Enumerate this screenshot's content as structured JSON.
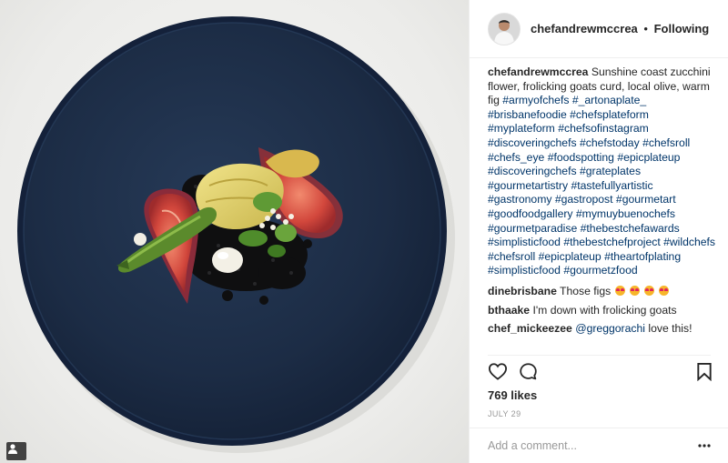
{
  "post": {
    "username": "chefandrewmccrea",
    "separator": "•",
    "follow_status": "Following",
    "caption": {
      "author": "chefandrewmccrea",
      "text": "Sunshine coast zucchini flower, frolicking goats curd, local olive, warm fig",
      "hashtags": [
        "#armyofchefs",
        "#_artonaplate_",
        "#brisbanefoodie",
        "#chefsplateform",
        "#myplateform",
        "#chefsofinstagram",
        "#discoveringchefs",
        "#chefstoday",
        "#chefsroll",
        "#chefs_eye",
        "#foodspotting",
        "#epicplateup",
        "#discoveringchefs",
        "#grateplates",
        "#gourmetartistry",
        "#tastefullyartistic",
        "#gastronomy",
        "#gastropost",
        "#gourmetart",
        "#goodfoodgallery",
        "#mymuybuenochefs",
        "#gourmetparadise",
        "#thebestchefawards",
        "#simplisticfood",
        "#thebestchefproject",
        "#wildchefs",
        "#chefsroll",
        "#epicplateup",
        "#theartofplating",
        "#simplisticfood",
        "#gourmetzfood"
      ]
    },
    "comments": [
      {
        "author": "dinebrisbane",
        "text": "Those figs",
        "emoji_count": 4,
        "emoji_icon": "heart-eyes-emoji"
      },
      {
        "author": "bthaake",
        "text": "I'm down with frolicking goats"
      },
      {
        "author": "chef_mickeezee",
        "mention": "@greggorachi",
        "text": "love this!"
      }
    ],
    "likes": "769 likes",
    "date": "JULY 29",
    "comment_placeholder": "Add a comment...",
    "icons": {
      "like": "heart-icon",
      "comment": "comment-bubble-icon",
      "save": "bookmark-icon",
      "more": "more-options-icon",
      "tagged": "tagged-user-icon"
    },
    "colors": {
      "hashtag": "#003569",
      "text": "#262626",
      "muted": "#999999",
      "divider": "#efefef",
      "plate": "#1d2d45"
    }
  }
}
